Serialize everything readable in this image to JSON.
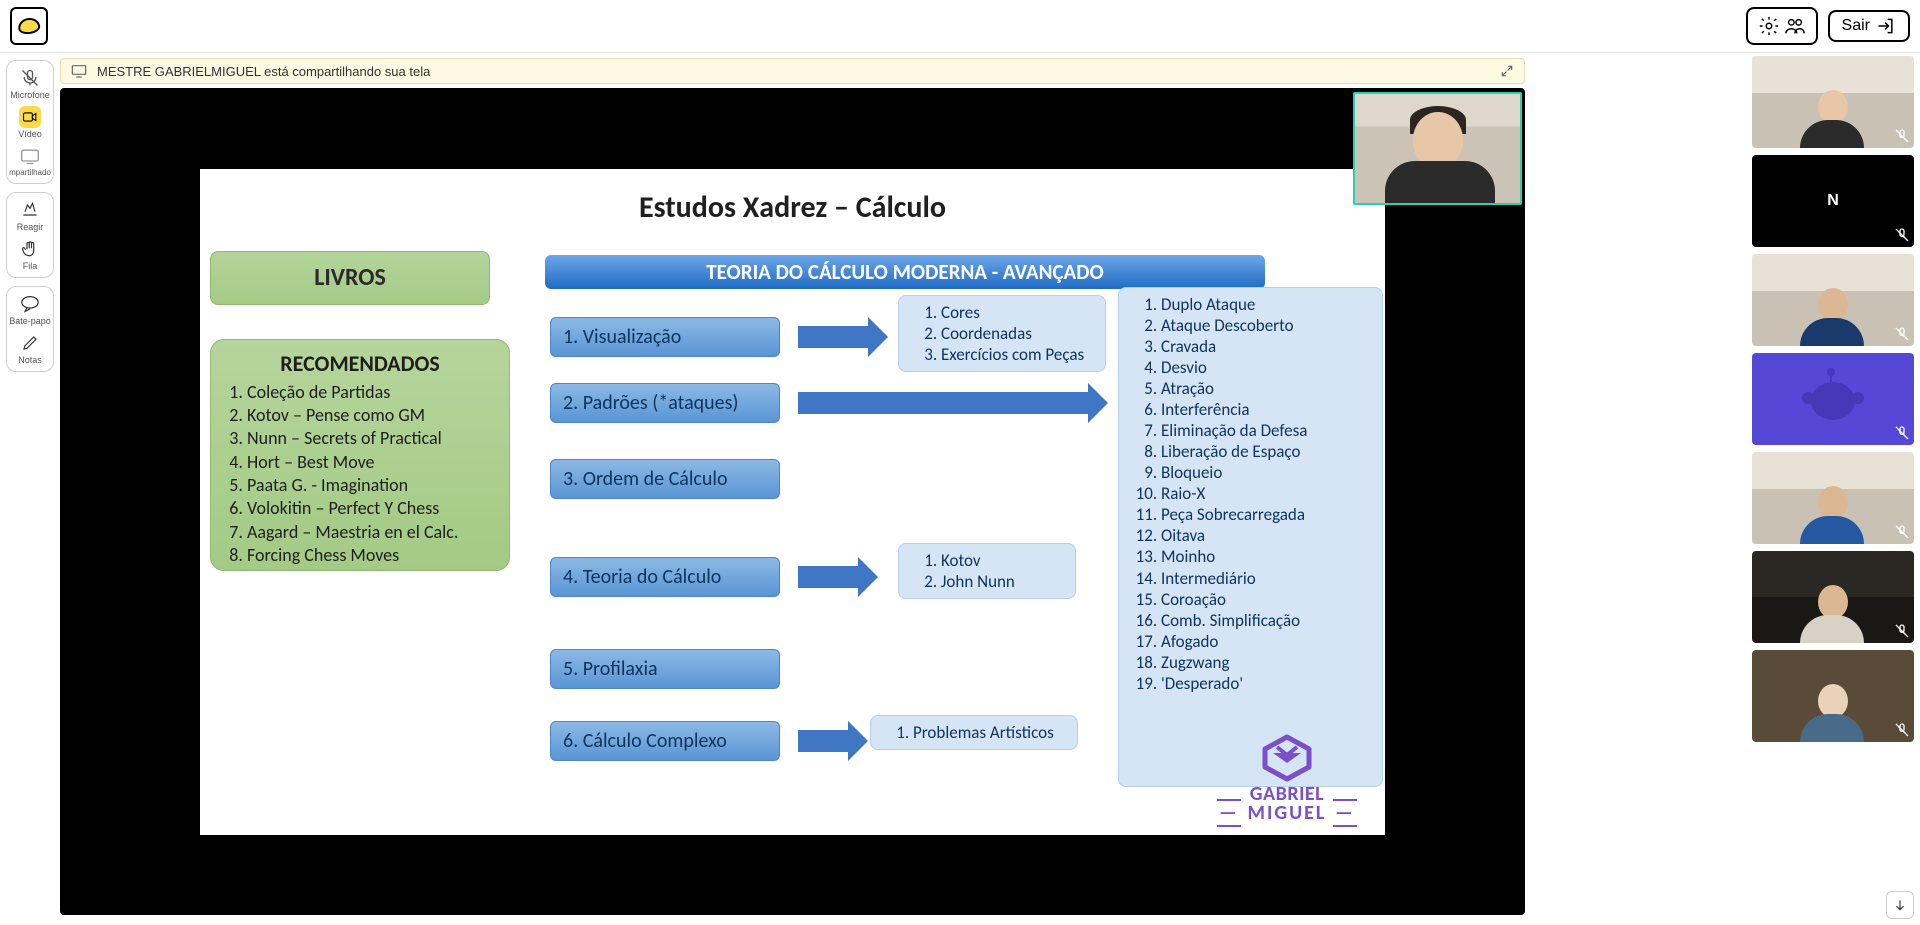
{
  "topbar": {
    "exit": "Sair"
  },
  "tools": {
    "mic": "Microfone",
    "video": "Vídeo",
    "share": "mpartilhado",
    "react": "Reagir",
    "queue": "Fila",
    "chat": "Bate-papo",
    "notes": "Notas"
  },
  "banner": {
    "text": "MESTRE GABRIELMIGUEL está compartilhando sua tela"
  },
  "slide": {
    "title": "Estudos Xadrez – Cálculo",
    "books_hdr": "LIVROS",
    "books_title": "RECOMENDADOS",
    "books": [
      "Coleção de Partidas",
      "Kotov – Pense como GM",
      "Nunn – Secrets of Practical",
      "Hort – Best Move",
      "Paata G. - Imagination",
      "Volokitin – Perfect Y Chess",
      "Aagard – Maestria en el Calc.",
      "Forcing Chess Moves"
    ],
    "blue_hdr": "TEORIA DO CÁLCULO MODERNA - AVANÇADO",
    "steps": {
      "s1": "1. Visualização",
      "s2": "2. Padrões (*ataques)",
      "s3": "3. Ordem de Cálculo",
      "s4": "4. Teoria do Cálculo",
      "s5": "5. Profilaxia",
      "s6": "6. Cálculo Complexo"
    },
    "sb1": [
      "Cores",
      "Coordenadas",
      "Exercícios com Peças"
    ],
    "sb2": [
      "Duplo Ataque",
      "Ataque Descoberto",
      "Cravada",
      "Desvio",
      "Atração",
      "Interferência",
      "Eliminação da Defesa",
      "Liberação de Espaço",
      "Bloqueio",
      "Raio-X",
      "Peça Sobrecarregada",
      "Oitava",
      "Moinho",
      "Intermediário",
      "Coroação",
      "Comb.  Simplificação",
      "Afogado",
      "Zugzwang",
      "'Desperado'"
    ],
    "sb4": [
      "Kotov",
      "John Nunn"
    ],
    "sb6": [
      "Problemas Artísticos"
    ],
    "logo": {
      "line1": "GABRIEL",
      "line2": "MIGUEL"
    }
  },
  "participants": {
    "letter_tile": "N"
  }
}
